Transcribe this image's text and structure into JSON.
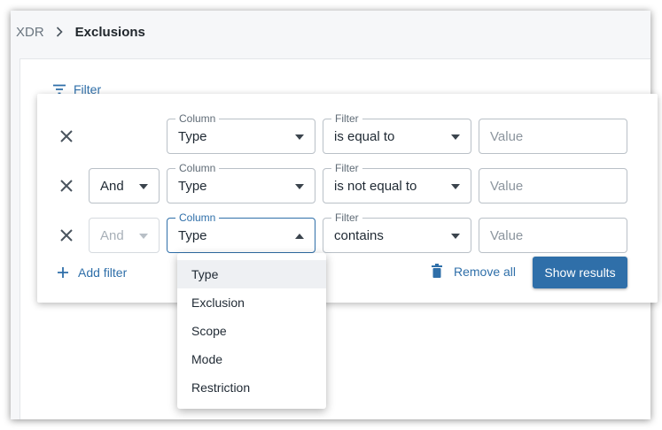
{
  "breadcrumb": {
    "root": "XDR",
    "current": "Exclusions"
  },
  "filter_toggle": {
    "label": "Filter"
  },
  "rows": [
    {
      "connector": "",
      "column_legend": "Column",
      "column_value": "Type",
      "filter_legend": "Filter",
      "filter_value": "is equal to",
      "value_placeholder": "Value"
    },
    {
      "connector": "And",
      "column_legend": "Column",
      "column_value": "Type",
      "filter_legend": "Filter",
      "filter_value": "is not equal to",
      "value_placeholder": "Value"
    },
    {
      "connector": "And",
      "column_legend": "Column",
      "column_value": "Type",
      "filter_legend": "Filter",
      "filter_value": "contains",
      "value_placeholder": "Value"
    }
  ],
  "actions": {
    "add_filter": "Add filter",
    "remove_all": "Remove all",
    "show_results": "Show results"
  },
  "column_dropdown": {
    "options": [
      "Type",
      "Exclusion",
      "Scope",
      "Mode",
      "Restriction"
    ],
    "selected": "Type"
  },
  "colors": {
    "accent": "#2f6fa9",
    "button_bg": "#2f6fa9",
    "border": "#b9c0c7"
  },
  "icons": {
    "filter": "filter-lines-icon",
    "remove_row": "close-icon",
    "add": "plus-icon",
    "remove_all": "trash-icon",
    "breadcrumb_sep": "chevron-right-icon"
  }
}
